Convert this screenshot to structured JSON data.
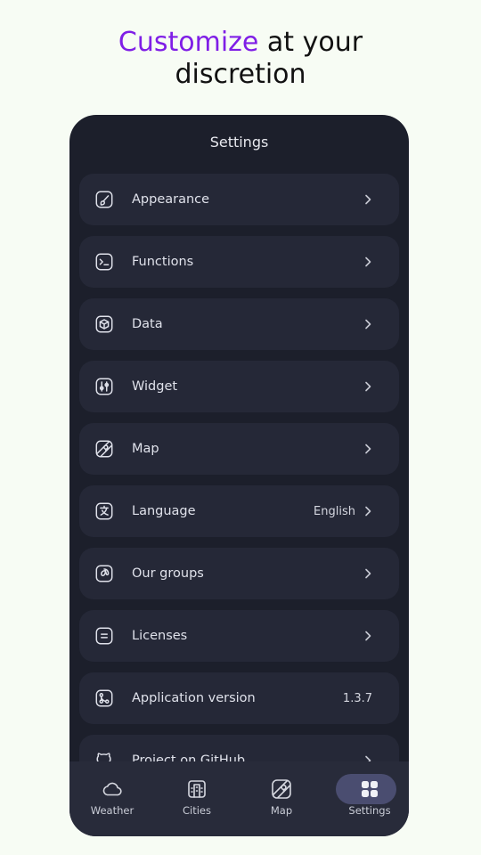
{
  "headline": {
    "accent": "Customize",
    "rest_line1": " at your",
    "line2": "discretion"
  },
  "colors": {
    "accent": "#7f1ee6",
    "panel": "#1c1f2b",
    "row": "#252837",
    "tab_active": "#4a4d70"
  },
  "screen_title": "Settings",
  "settings": [
    {
      "label": "Appearance",
      "icon": "brush-icon"
    },
    {
      "label": "Functions",
      "icon": "terminal-icon"
    },
    {
      "label": "Data",
      "icon": "cube-icon"
    },
    {
      "label": "Widget",
      "icon": "sliders-icon"
    },
    {
      "label": "Map",
      "icon": "map-icon"
    },
    {
      "label": "Language",
      "icon": "translate-icon",
      "value": "English"
    },
    {
      "label": "Our groups",
      "icon": "at-icon"
    },
    {
      "label": "Licenses",
      "icon": "document-icon"
    },
    {
      "label": "Application version",
      "icon": "git-branch-icon",
      "value": "1.3.7"
    },
    {
      "label": "Project on GitHub",
      "icon": "github-icon"
    }
  ],
  "tabs": [
    {
      "label": "Weather",
      "icon": "cloud-icon"
    },
    {
      "label": "Cities",
      "icon": "buildings-icon"
    },
    {
      "label": "Map",
      "icon": "map-icon"
    },
    {
      "label": "Settings",
      "icon": "grid-icon",
      "active": true
    }
  ]
}
